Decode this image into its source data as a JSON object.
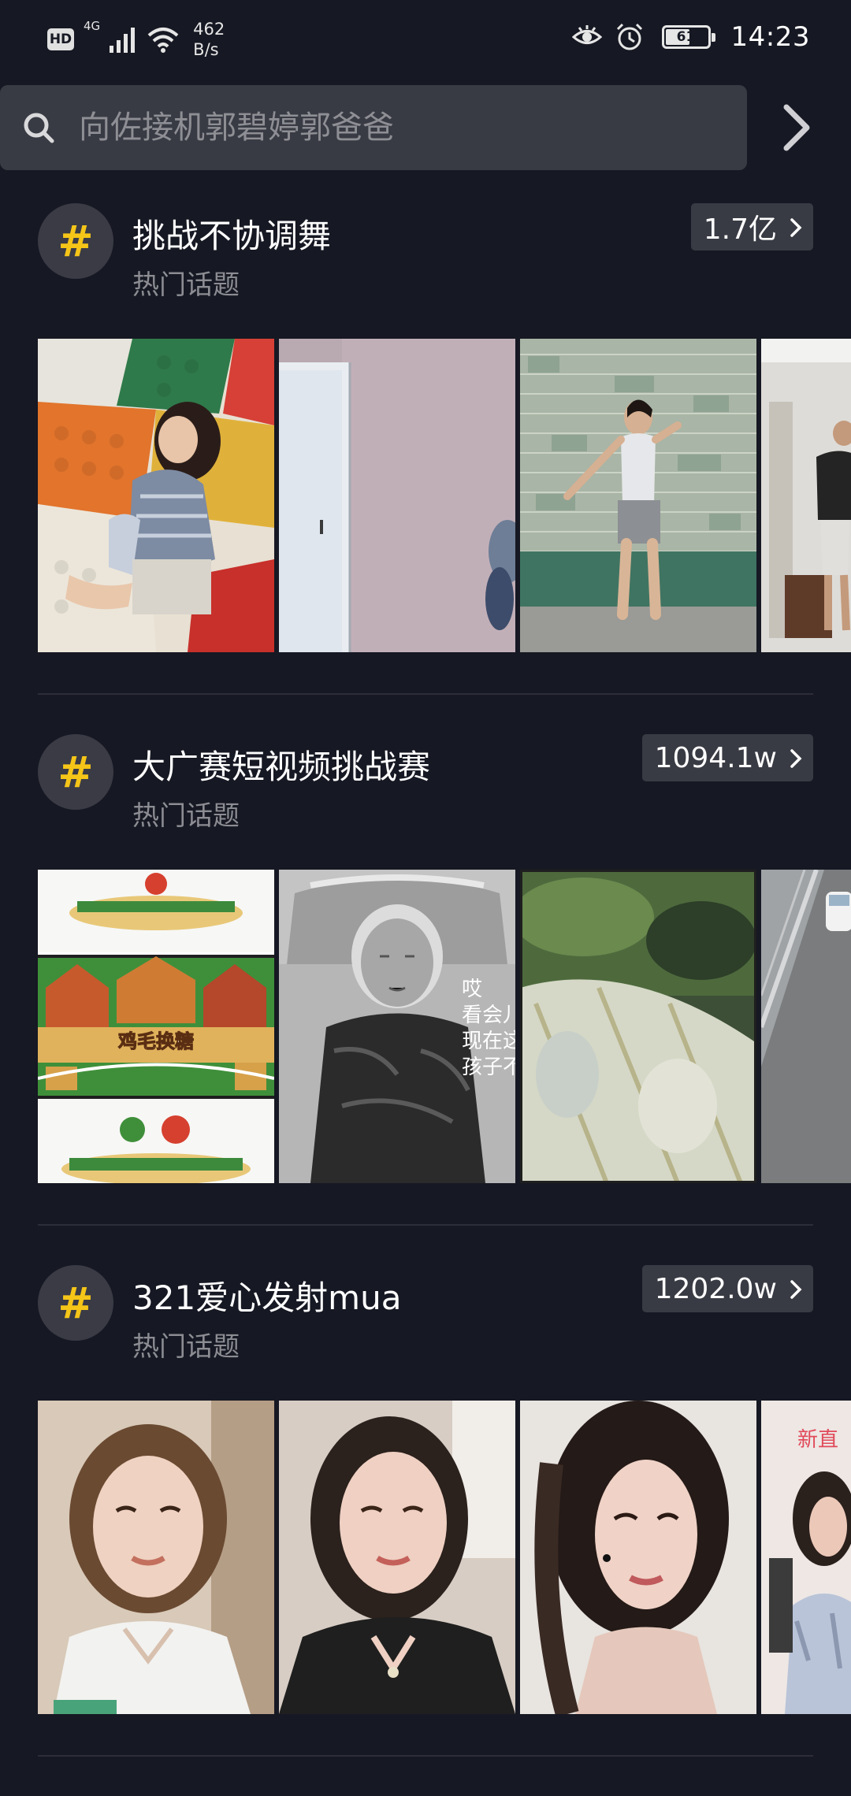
{
  "status_bar": {
    "hd": "HD",
    "net_type": "4G",
    "net_speed_value": "462",
    "net_speed_unit": "B/s",
    "battery": "61",
    "battery_level": 0.61,
    "time": "14:23"
  },
  "search": {
    "placeholder": "向佐接机郭碧婷郭爸爸",
    "icon": "search-icon"
  },
  "topics": [
    {
      "title": "挑战不协调舞",
      "subtitle": "热门话题",
      "count": "1.7亿"
    },
    {
      "title": "大广赛短视频挑战赛",
      "subtitle": "热门话题",
      "count": "1094.1w"
    },
    {
      "title": "321爱心发射mua",
      "subtitle": "热门话题",
      "count": "1202.0w"
    }
  ],
  "thumb_texts": {
    "poster_lottery": "鸡毛换糖",
    "caption_lines": [
      "哎",
      "看会儿",
      "现在这",
      "孩子不"
    ],
    "partial_text": "新直"
  },
  "colors": {
    "background": "#161823",
    "hash_accent": "#f5c518",
    "badge_bg": "#393b44",
    "subtitle": "#8c8d93"
  }
}
